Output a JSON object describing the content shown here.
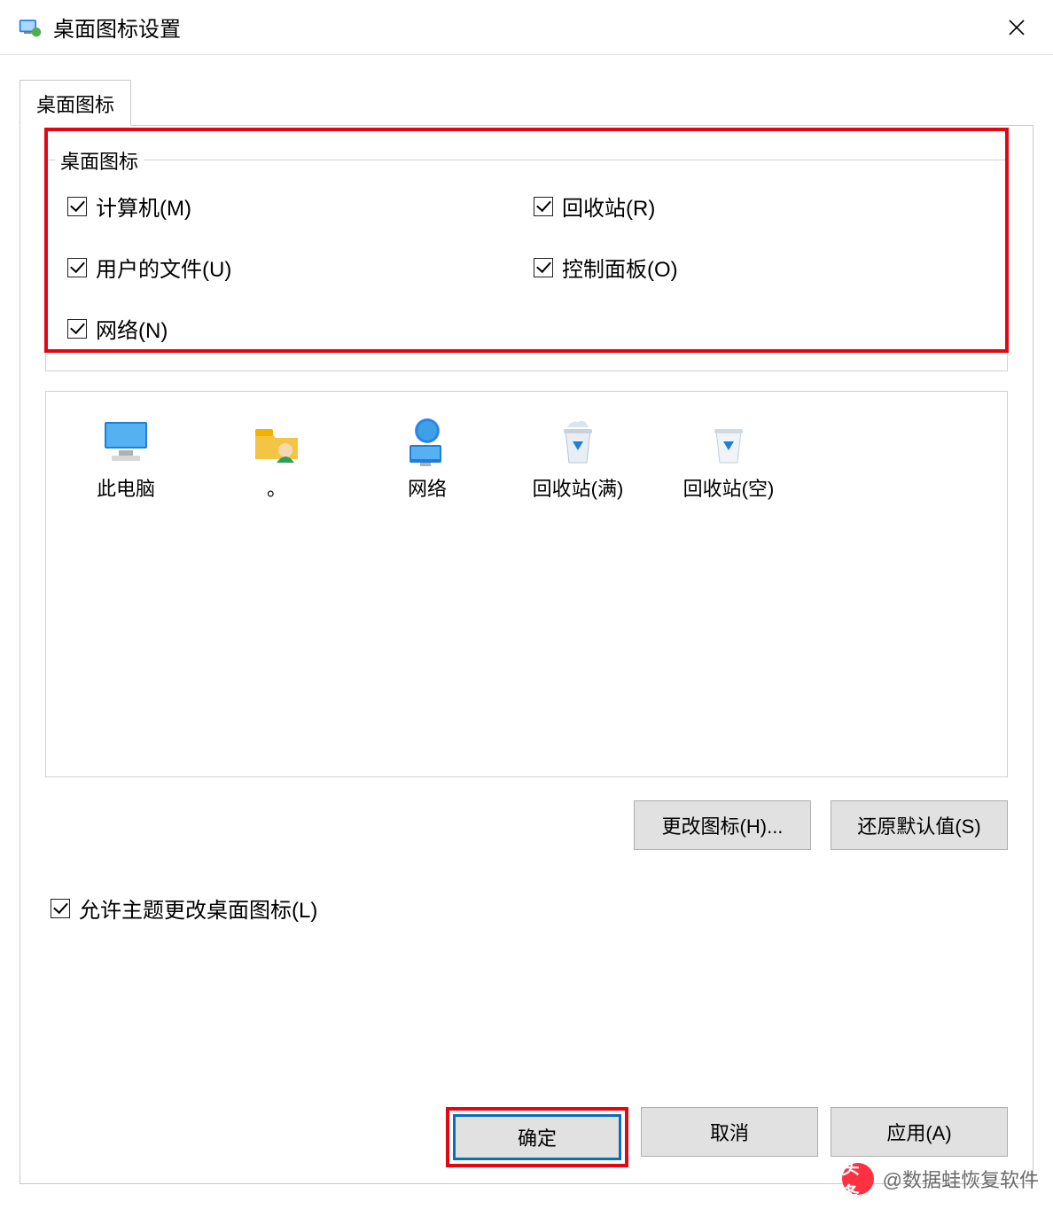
{
  "window": {
    "title": "桌面图标设置"
  },
  "tab": {
    "label": "桌面图标"
  },
  "group": {
    "legend": "桌面图标",
    "checks": {
      "computer": "计算机(M)",
      "recycle": "回收站(R)",
      "userfiles": "用户的文件(U)",
      "controlpanel": "控制面板(O)",
      "network": "网络(N)"
    }
  },
  "icons": {
    "thispc": "此电脑",
    "user": "。",
    "network": "网络",
    "recycle_full": "回收站(满)",
    "recycle_empty": "回收站(空)"
  },
  "buttons": {
    "change_icon": "更改图标(H)...",
    "restore_default": "还原默认值(S)",
    "ok": "确定",
    "cancel": "取消",
    "apply": "应用(A)"
  },
  "allow_theme": "允许主题更改桌面图标(L)",
  "watermark": "@数据蛙恢复软件",
  "watermark_prefix": "头条"
}
